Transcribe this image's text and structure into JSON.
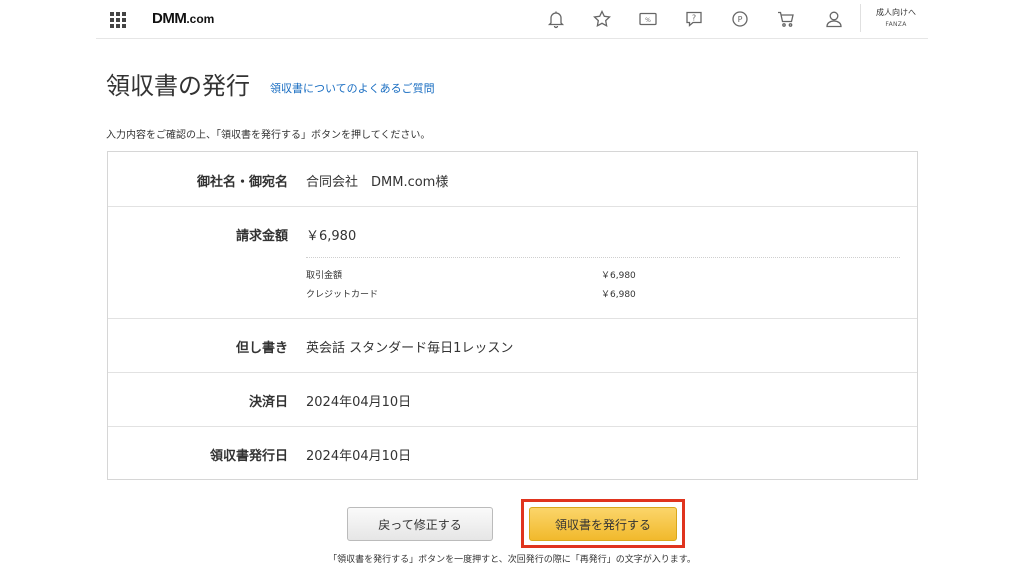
{
  "header": {
    "logo_main": "DMM",
    "logo_suffix": ".com",
    "icons": [
      "bell-icon",
      "star-icon",
      "coupon-icon",
      "help-icon",
      "point-icon",
      "cart-icon",
      "user-icon",
      "apps-grid-icon"
    ],
    "adult_line1": "成人向けへ",
    "adult_line2": "FANZA"
  },
  "page": {
    "title": "領収書の発行",
    "faq_link": "領収書についてのよくあるご質問",
    "instruction": "入力内容をご確認の上、「領収書を発行する」ボタンを押してください。"
  },
  "form": {
    "name_label": "御社名・御宛名",
    "name_value": "合同会社　DMM.com様",
    "amount_label": "請求金額",
    "amount_value": "￥6,980",
    "breakdown": [
      {
        "label": "取引金額",
        "value": "￥6,980"
      },
      {
        "label": "クレジットカード",
        "value": "￥6,980"
      }
    ],
    "proviso_label": "但し書き",
    "proviso_value": "英会話 スタンダード毎日1レッスン",
    "settlement_label": "決済日",
    "settlement_value": "2024年04月10日",
    "issue_date_label": "領収書発行日",
    "issue_date_value": "2024年04月10日"
  },
  "actions": {
    "back_label": "戻って修正する",
    "issue_label": "領収書を発行する",
    "note": "「領収書を発行する」ボタンを一度押すと、次回発行の際に「再発行」の文字が入ります。"
  },
  "colors": {
    "link": "#1a6ec2",
    "issue_button": "#f4c343",
    "highlight_outline": "#e0341e"
  }
}
